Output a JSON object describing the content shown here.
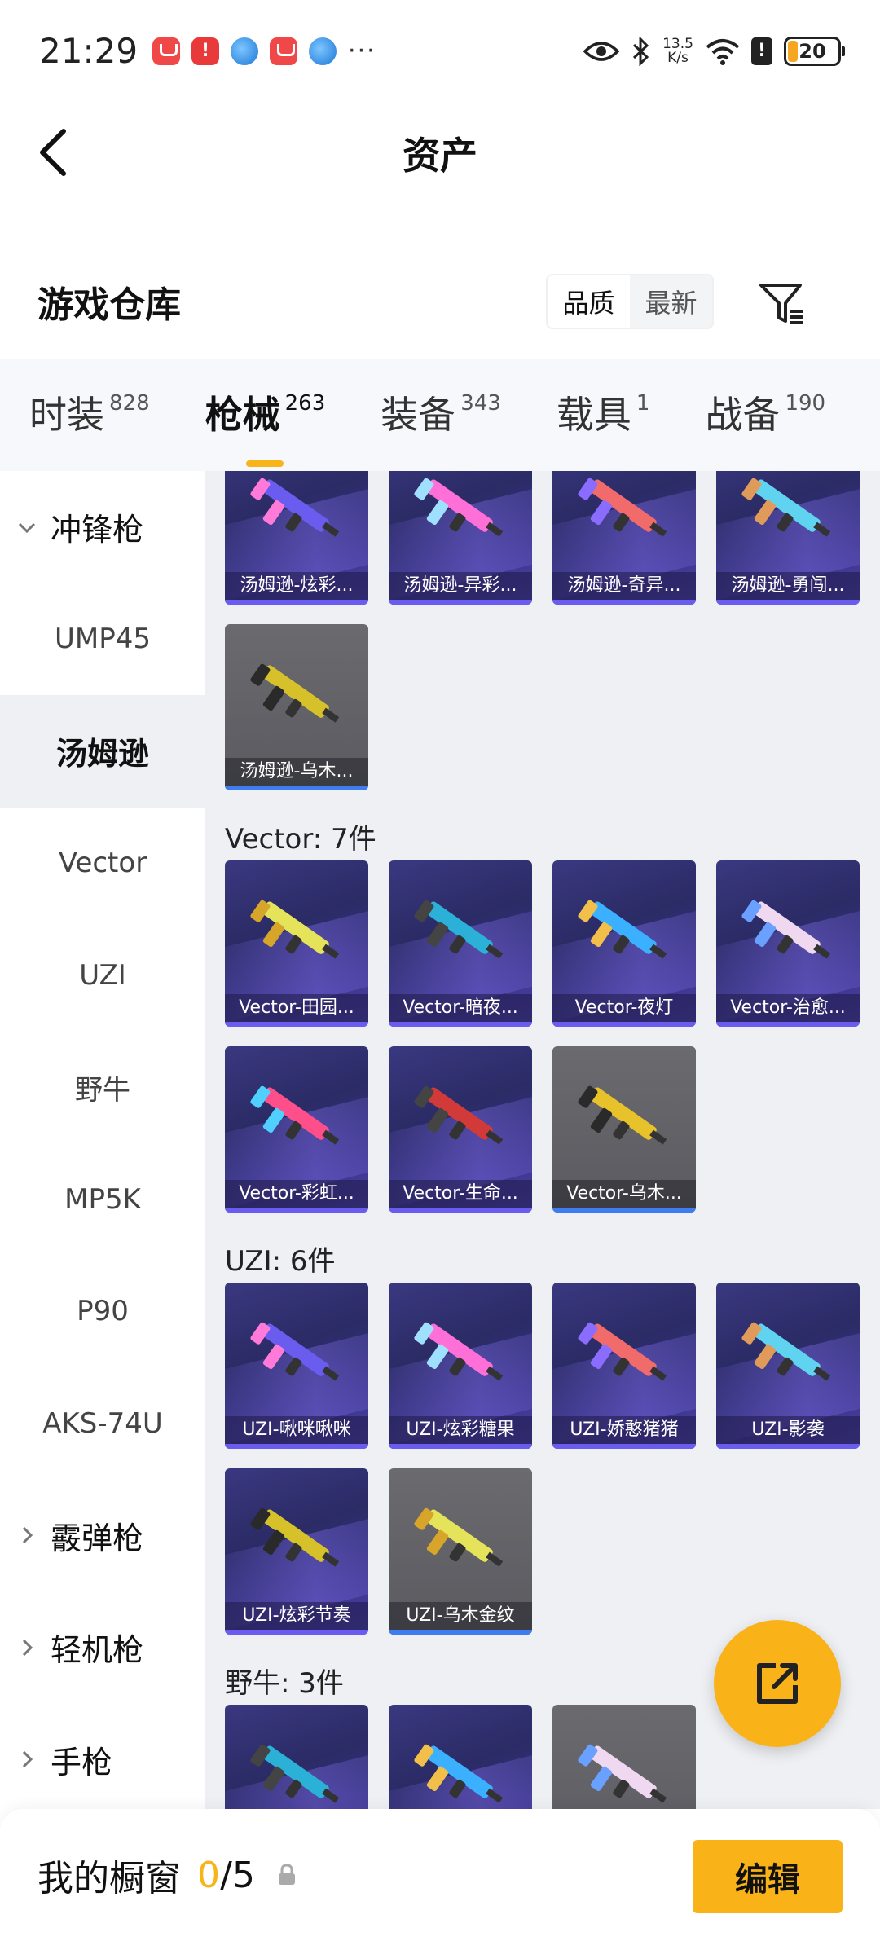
{
  "status_bar": {
    "time": "21:29",
    "more": "···",
    "net_speed_value": "13.5",
    "net_speed_unit": "K/s",
    "battery": "20",
    "battery_level": 0.2
  },
  "header": {
    "title": "资产"
  },
  "section": {
    "title": "游戏仓库",
    "sort_options": [
      "品质",
      "最新"
    ],
    "sort_selected": "品质"
  },
  "tabs": [
    {
      "label": "时装",
      "count": "828"
    },
    {
      "label": "枪械",
      "count": "263"
    },
    {
      "label": "装备",
      "count": "343"
    },
    {
      "label": "载具",
      "count": "1"
    },
    {
      "label": "战备",
      "count": "190"
    }
  ],
  "active_tab": "枪械",
  "sidebar": [
    {
      "label": "冲锋枪",
      "type": "group",
      "expanded": true
    },
    {
      "label": "UMP45",
      "type": "item"
    },
    {
      "label": "汤姆逊",
      "type": "item",
      "active": true
    },
    {
      "label": "Vector",
      "type": "item"
    },
    {
      "label": "UZI",
      "type": "item"
    },
    {
      "label": "野牛",
      "type": "item"
    },
    {
      "label": "MP5K",
      "type": "item"
    },
    {
      "label": "P90",
      "type": "item"
    },
    {
      "label": "AKS-74U",
      "type": "item"
    },
    {
      "label": "霰弹枪",
      "type": "group",
      "expanded": false
    },
    {
      "label": "轻机枪",
      "type": "group",
      "expanded": false
    },
    {
      "label": "手枪",
      "type": "group",
      "expanded": false
    }
  ],
  "groups": [
    {
      "title": "",
      "items": [
        {
          "name": "汤姆逊-炫彩...",
          "quality": "purple"
        },
        {
          "name": "汤姆逊-异彩...",
          "quality": "purple"
        },
        {
          "name": "汤姆逊-奇异...",
          "quality": "purple"
        },
        {
          "name": "汤姆逊-勇闯...",
          "quality": "purple"
        },
        {
          "name": "汤姆逊-乌木...",
          "quality": "gray"
        }
      ]
    },
    {
      "title": "Vector: 7件",
      "items": [
        {
          "name": "Vector-田园...",
          "quality": "purple"
        },
        {
          "name": "Vector-暗夜...",
          "quality": "purple"
        },
        {
          "name": "Vector-夜灯",
          "quality": "purple"
        },
        {
          "name": "Vector-治愈...",
          "quality": "purple"
        },
        {
          "name": "Vector-彩虹...",
          "quality": "purple"
        },
        {
          "name": "Vector-生命...",
          "quality": "purple"
        },
        {
          "name": "Vector-乌木...",
          "quality": "gray"
        }
      ]
    },
    {
      "title": "UZI: 6件",
      "items": [
        {
          "name": "UZI-啾咪啾咪",
          "quality": "purple"
        },
        {
          "name": "UZI-炫彩糖果",
          "quality": "purple"
        },
        {
          "name": "UZI-娇憨猪猪",
          "quality": "purple"
        },
        {
          "name": "UZI-影袭",
          "quality": "purple"
        },
        {
          "name": "UZI-炫彩节奏",
          "quality": "purple"
        },
        {
          "name": "UZI-乌木金纹",
          "quality": "gray"
        }
      ]
    },
    {
      "title": "野牛: 3件",
      "items": [
        {
          "name": "",
          "quality": "purple"
        },
        {
          "name": "",
          "quality": "purple"
        },
        {
          "name": "",
          "quality": "gray"
        }
      ]
    }
  ],
  "bottom": {
    "title": "我的橱窗",
    "used": "0",
    "total": "/5",
    "edit_label": "编辑"
  },
  "colors": {
    "accent": "#f9b319",
    "purple_card": "#3a3880",
    "gray_card": "#606066",
    "sidebar_active_bg": "#eef0f4"
  }
}
